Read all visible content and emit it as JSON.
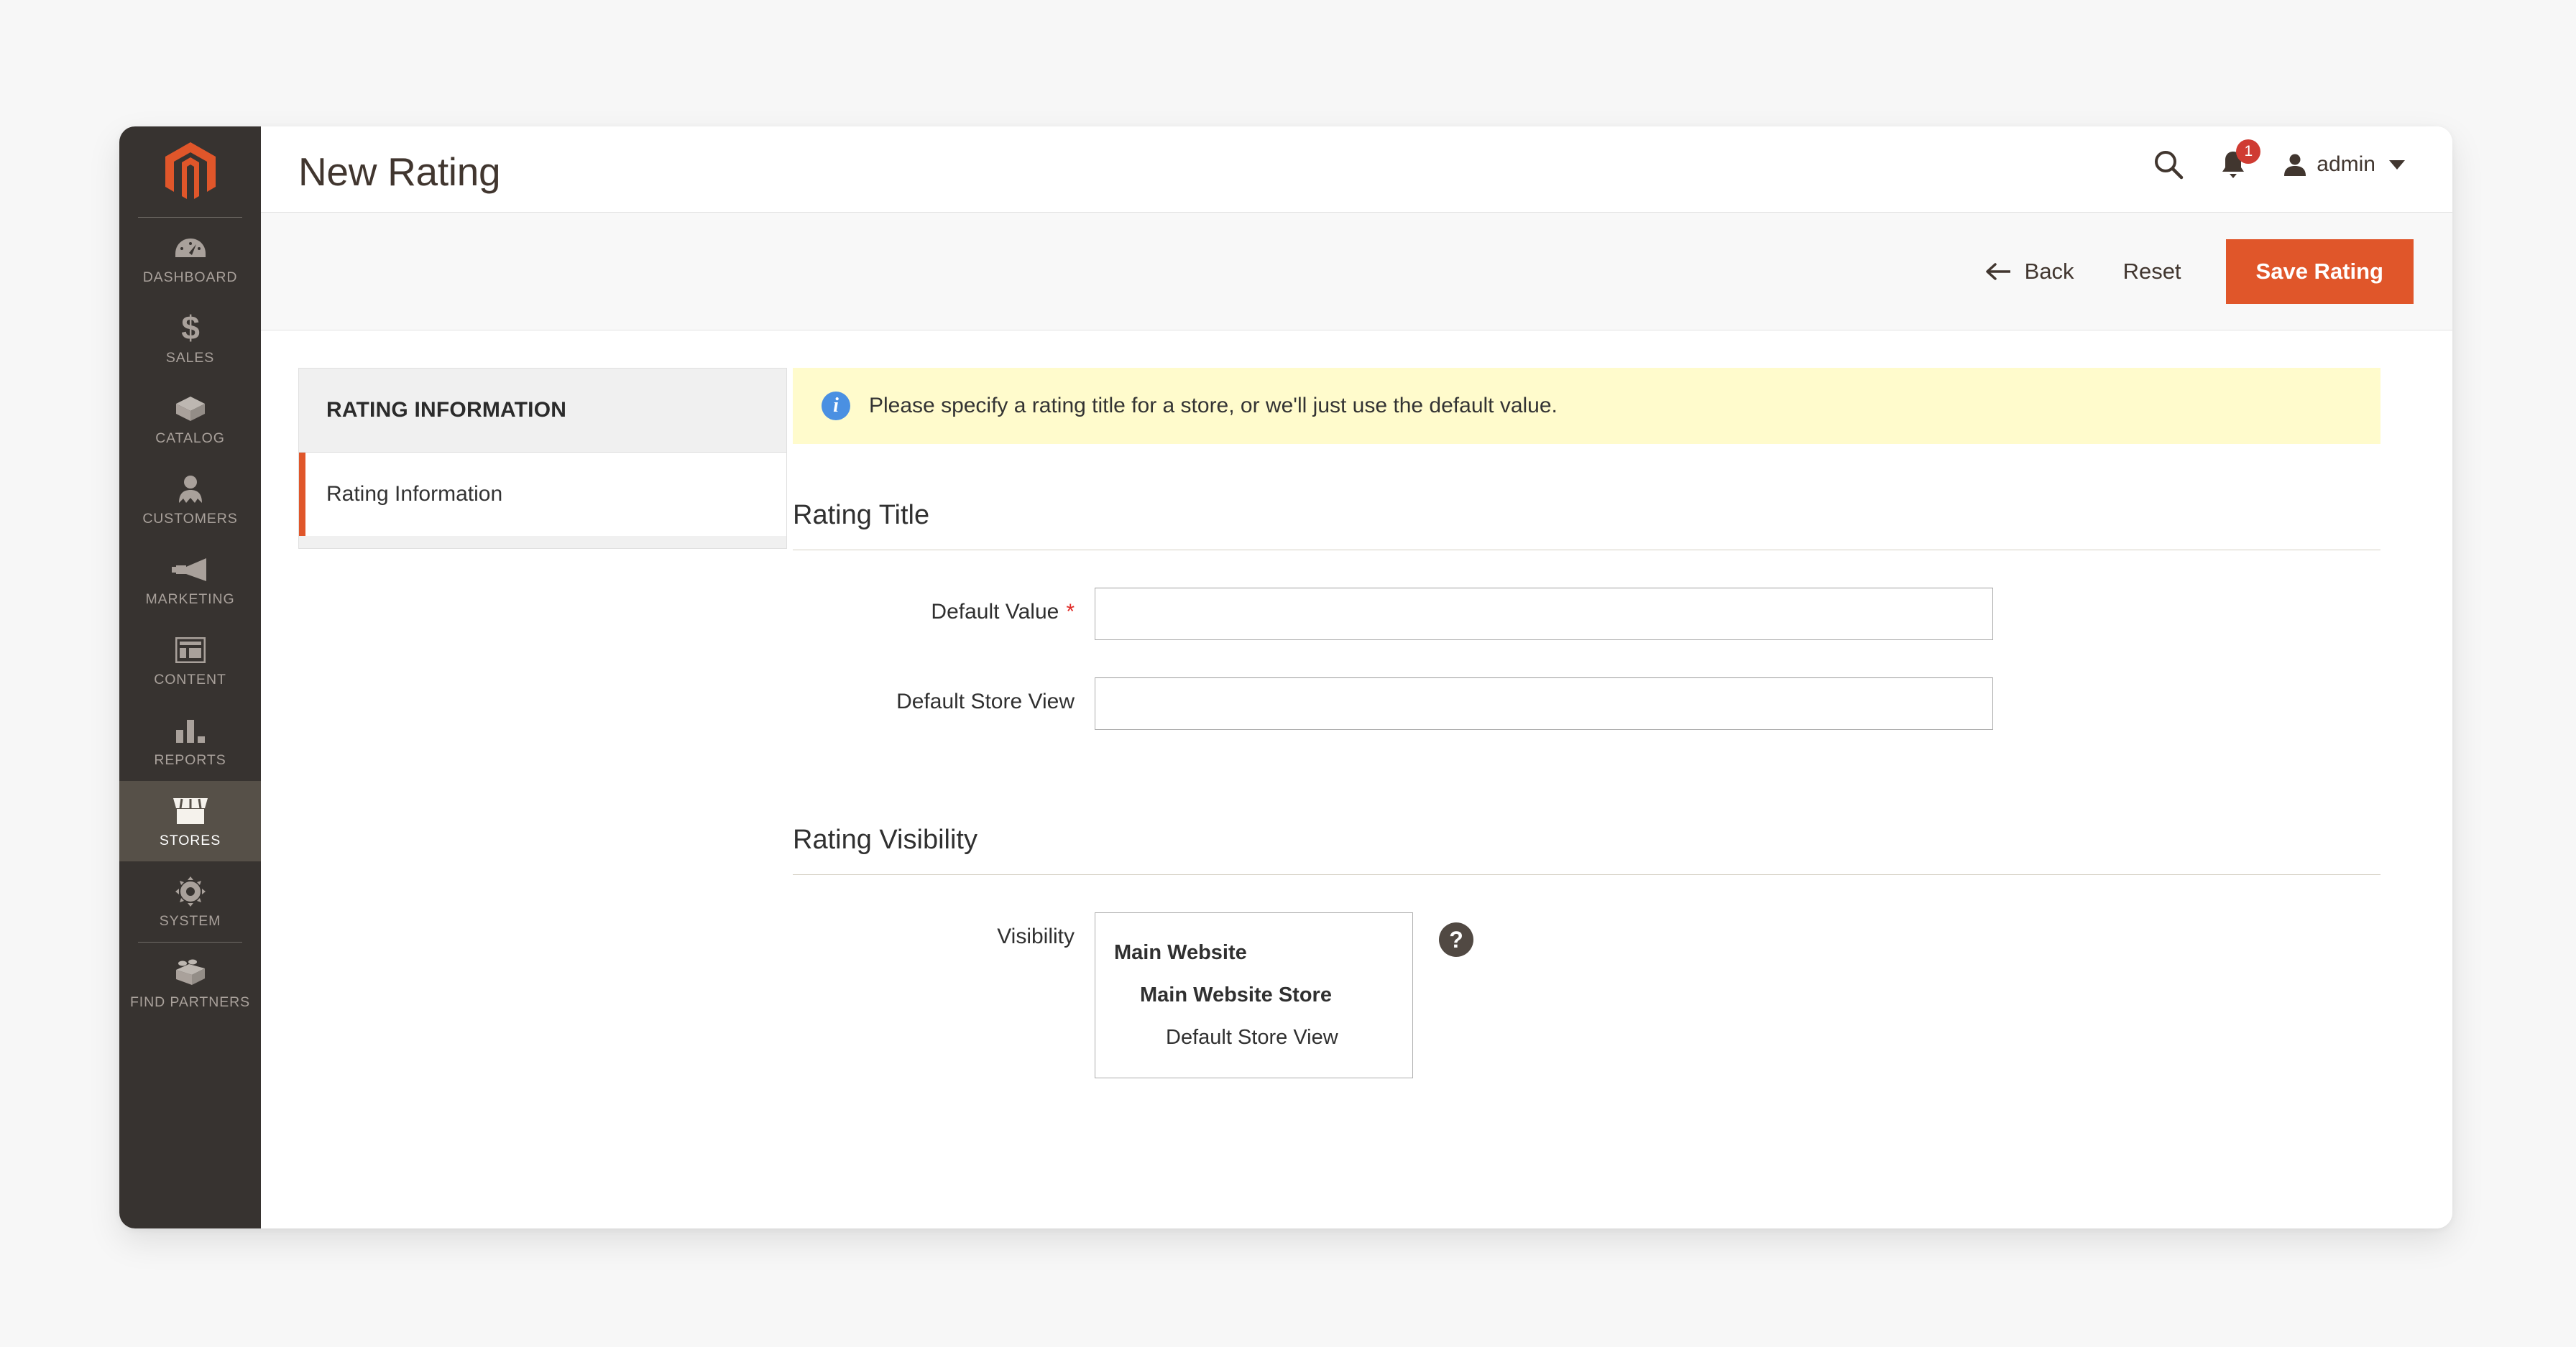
{
  "header": {
    "title": "New Rating",
    "search_icon": "search-icon",
    "notifications": {
      "icon": "bell-icon",
      "count": "1"
    },
    "user": {
      "avatar_icon": "user-avatar-icon",
      "name": "admin",
      "caret_icon": "chevron-down-icon"
    }
  },
  "page_actions": {
    "back_label": "Back",
    "back_icon": "arrow-left-icon",
    "reset_label": "Reset",
    "save_label": "Save Rating"
  },
  "sidebar": {
    "logo_icon": "magento-logo-icon",
    "items": [
      {
        "label": "Dashboard",
        "icon": "dashboard-gauge-icon",
        "active": false
      },
      {
        "label": "Sales",
        "icon": "dollar-sign-icon",
        "active": false
      },
      {
        "label": "Catalog",
        "icon": "box-icon",
        "active": false
      },
      {
        "label": "Customers",
        "icon": "person-icon",
        "active": false
      },
      {
        "label": "Marketing",
        "icon": "megaphone-icon",
        "active": false
      },
      {
        "label": "Content",
        "icon": "layout-page-icon",
        "active": false
      },
      {
        "label": "Reports",
        "icon": "bar-chart-icon",
        "active": false
      },
      {
        "label": "Stores",
        "icon": "storefront-icon",
        "active": true
      },
      {
        "label": "System",
        "icon": "gear-icon",
        "active": false
      },
      {
        "label": "Find Partners",
        "icon": "lego-brick-icon",
        "active": false
      }
    ]
  },
  "tabs_panel": {
    "heading": "RATING INFORMATION",
    "items": [
      {
        "label": "Rating Information",
        "active": true
      }
    ]
  },
  "notice": {
    "icon": "info-icon",
    "text": "Please specify a rating title for a store, or we'll just use the default value."
  },
  "rating_title_section": {
    "title": "Rating Title",
    "fields": [
      {
        "label": "Default Value",
        "required": true,
        "required_marker": "*",
        "value": "",
        "placeholder": ""
      },
      {
        "label": "Default Store View",
        "required": false,
        "required_marker": "",
        "value": "",
        "placeholder": ""
      }
    ]
  },
  "rating_visibility_section": {
    "title": "Rating Visibility",
    "field_label": "Visibility",
    "help_icon_label": "?",
    "options": [
      {
        "label": "Main Website",
        "level": 0,
        "selected": false
      },
      {
        "label": "Main Website Store",
        "level": 1,
        "selected": false
      },
      {
        "label": "Default Store View",
        "level": 2,
        "selected": false
      }
    ]
  },
  "colors": {
    "accent_orange": "#e0562a",
    "sidebar_bg": "#373330",
    "sidebar_active_bg": "#565048",
    "notice_bg": "#fffbcc",
    "badge_red": "#cf3b32",
    "info_blue": "#4a90e2",
    "required_red": "#e02b27"
  }
}
